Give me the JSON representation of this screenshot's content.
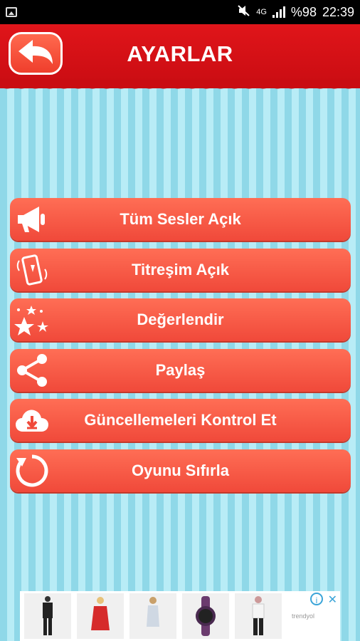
{
  "status": {
    "battery": "%98",
    "time": "22:39",
    "network": "4G"
  },
  "header": {
    "title": "AYARLAR"
  },
  "menu": [
    {
      "label": "Tüm Sesler Açık",
      "icon": "megaphone-icon"
    },
    {
      "label": "Titreşim Açık",
      "icon": "vibrating-phone-icon"
    },
    {
      "label": "Değerlendir",
      "icon": "stars-icon"
    },
    {
      "label": "Paylaş",
      "icon": "share-icon"
    },
    {
      "label": "Güncellemeleri Kontrol Et",
      "icon": "cloud-download-icon"
    },
    {
      "label": "Oyunu Sıfırla",
      "icon": "refresh-icon"
    }
  ],
  "ad": {
    "brand": "trendyol"
  },
  "colors": {
    "header_red": "#d21017",
    "button": "#f65a44",
    "stripe_dark": "#8fd8e8",
    "stripe_light": "#b8ecf6"
  }
}
